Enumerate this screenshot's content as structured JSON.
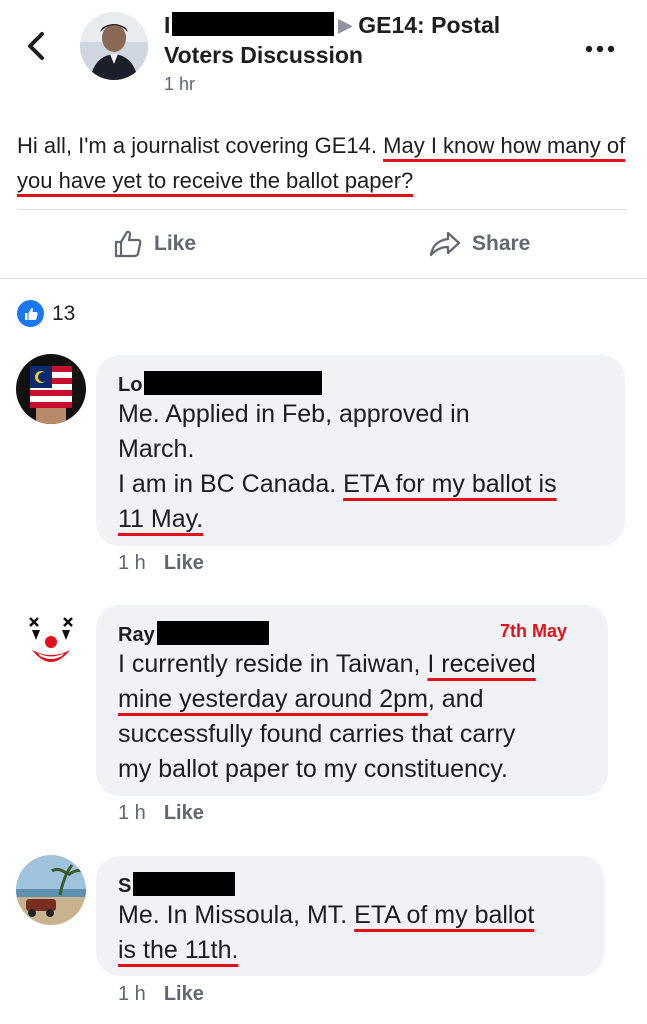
{
  "header": {
    "author_initial": "I",
    "group_name": "GE14: Postal Voters Discussion",
    "time": "1 hr",
    "back_icon": "chevron-left-icon",
    "more_icon": "more-horizontal-icon"
  },
  "post": {
    "text_before": "Hi all, I'm a journalist covering GE14. ",
    "text_underlined": "May I know how many of you have yet to receive the ballot paper?"
  },
  "actions": {
    "like_label": "Like",
    "share_label": "Share"
  },
  "reactions": {
    "count": "13",
    "icon": "thumbs-up-icon"
  },
  "comments": [
    {
      "name_initial": "Lo",
      "line1": "Me. Applied in Feb, approved in",
      "line2": "March.",
      "line3_plain": "I am in BC Canada. ",
      "line3_ul": "ETA for my ballot is",
      "line4_ul": "11 May.",
      "time": "1 h",
      "like_label": "Like"
    },
    {
      "name_initial": "Ray",
      "annotation": "7th May",
      "line1_plain": "I currently reside in Taiwan, ",
      "line1_ul": "I received",
      "line2_ul": "mine yesterday around 2pm",
      "line2_plain": ", and",
      "line3": "successfully found carries that carry",
      "line4": "my ballot paper to my constituency.",
      "time": "1 h",
      "like_label": "Like"
    },
    {
      "name_initial": "S",
      "line1_plain": "Me. In Missoula, MT. ",
      "line1_ul": "ETA of my ballot",
      "line2_ul": "is the 11th.",
      "time": "1 h",
      "like_label": "Like"
    }
  ],
  "colors": {
    "accent_blue": "#1877f2",
    "annotation_red": "#e0111b",
    "bubble_bg": "#f0f2f5"
  }
}
